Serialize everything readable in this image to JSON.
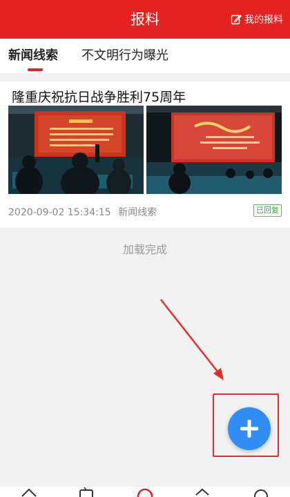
{
  "header": {
    "title": "报料",
    "my_report_label": "我的报料",
    "color": "#e52222"
  },
  "tabs": [
    {
      "label": "新闻线索",
      "active": true
    },
    {
      "label": "不文明行为曝光",
      "active": false
    }
  ],
  "card": {
    "title": "隆重庆祝抗日战争胜利75周年",
    "datetime": "2020-09-02 15:34:15",
    "category": "新闻线索",
    "status_badge": "已回复"
  },
  "list_footer": "加载完成",
  "fab": {
    "icon": "plus-icon",
    "color": "#2f8df3"
  },
  "annotation": {
    "color": "#e0302a"
  },
  "bottom_nav": {
    "icons": [
      "home-icon",
      "tv-icon",
      "report-icon",
      "service-icon",
      "user-icon"
    ]
  }
}
